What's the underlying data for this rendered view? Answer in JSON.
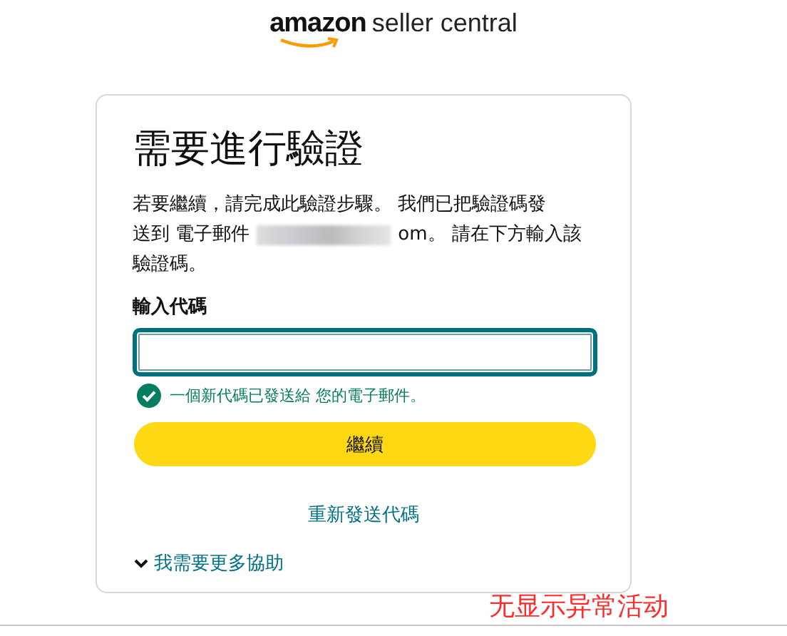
{
  "header": {
    "logo_brand": "amazon",
    "logo_product": "seller central"
  },
  "card": {
    "title": "需要進行驗證",
    "message_line_1": "若要繼續，請完成此驗證步驟。 我們已把驗證碼發",
    "message_line_2_before": "送到 電子郵件",
    "message_line_2_after": "om。 請在下方輸入該",
    "message_line_3": "驗證碼。",
    "code_field": {
      "label": "輸入代碼"
    },
    "notice": {
      "kind": "success",
      "text": "一個新代碼已發送給 您的電子郵件。"
    },
    "continue_button": "繼續",
    "resend_link": "重新發送代碼",
    "help": {
      "label": "我需要更多協助",
      "expanded": false
    }
  },
  "annotation": "无显示异常活动"
}
